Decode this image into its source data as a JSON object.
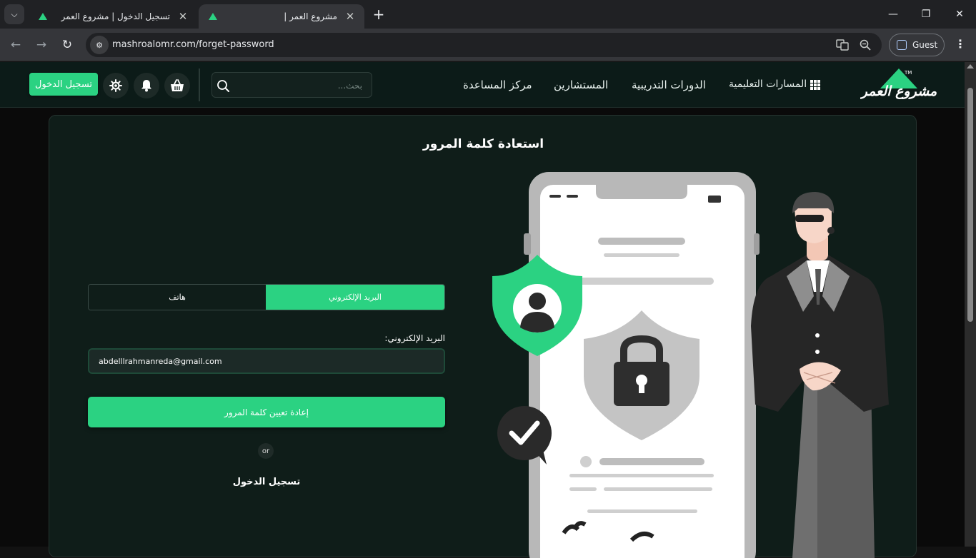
{
  "browser": {
    "tabs": [
      {
        "title": "تسجيل الدخول | مشروع العمر",
        "active": false
      },
      {
        "title": "| مشروع العمر",
        "active": true
      }
    ],
    "url": "mashroalomr.com/forget-password",
    "profile_label": "Guest"
  },
  "header": {
    "login_button": "تسجيل الدخول",
    "search_placeholder": "بحث...",
    "nav": {
      "learning_paths": "المسارات التعليمية",
      "training_courses": "الدورات التدريبية",
      "consultants": "المستشارين",
      "help_center": "مركز المساعدة"
    },
    "logo_text": "مشروع العمر",
    "logo_tm": "TM"
  },
  "main": {
    "title": "استعادة كلمة المرور",
    "tabs": {
      "email": "البريد الإلكتروني",
      "phone": "هاتف"
    },
    "email_label": "البريد الإلكتروني:",
    "email_value": "abdelllrahmanreda@gmail.com",
    "reset_button": "إعادة تعيين كلمة المرور",
    "or": "or",
    "login_link": "تسجيل الدخول"
  },
  "colors": {
    "accent": "#2bd282",
    "header_bg": "#0c1b18",
    "card_bg": "#0f1d19"
  },
  "icons": [
    "tab-search-icon",
    "close-icon",
    "plus-icon",
    "minimize-icon",
    "maximize-icon",
    "back-icon",
    "forward-icon",
    "reload-icon",
    "site-info-icon",
    "translate-icon",
    "zoom-icon",
    "profile-icon",
    "menu-icon",
    "settings-icon",
    "bell-icon",
    "basket-icon",
    "search-icon",
    "grid-icon"
  ]
}
